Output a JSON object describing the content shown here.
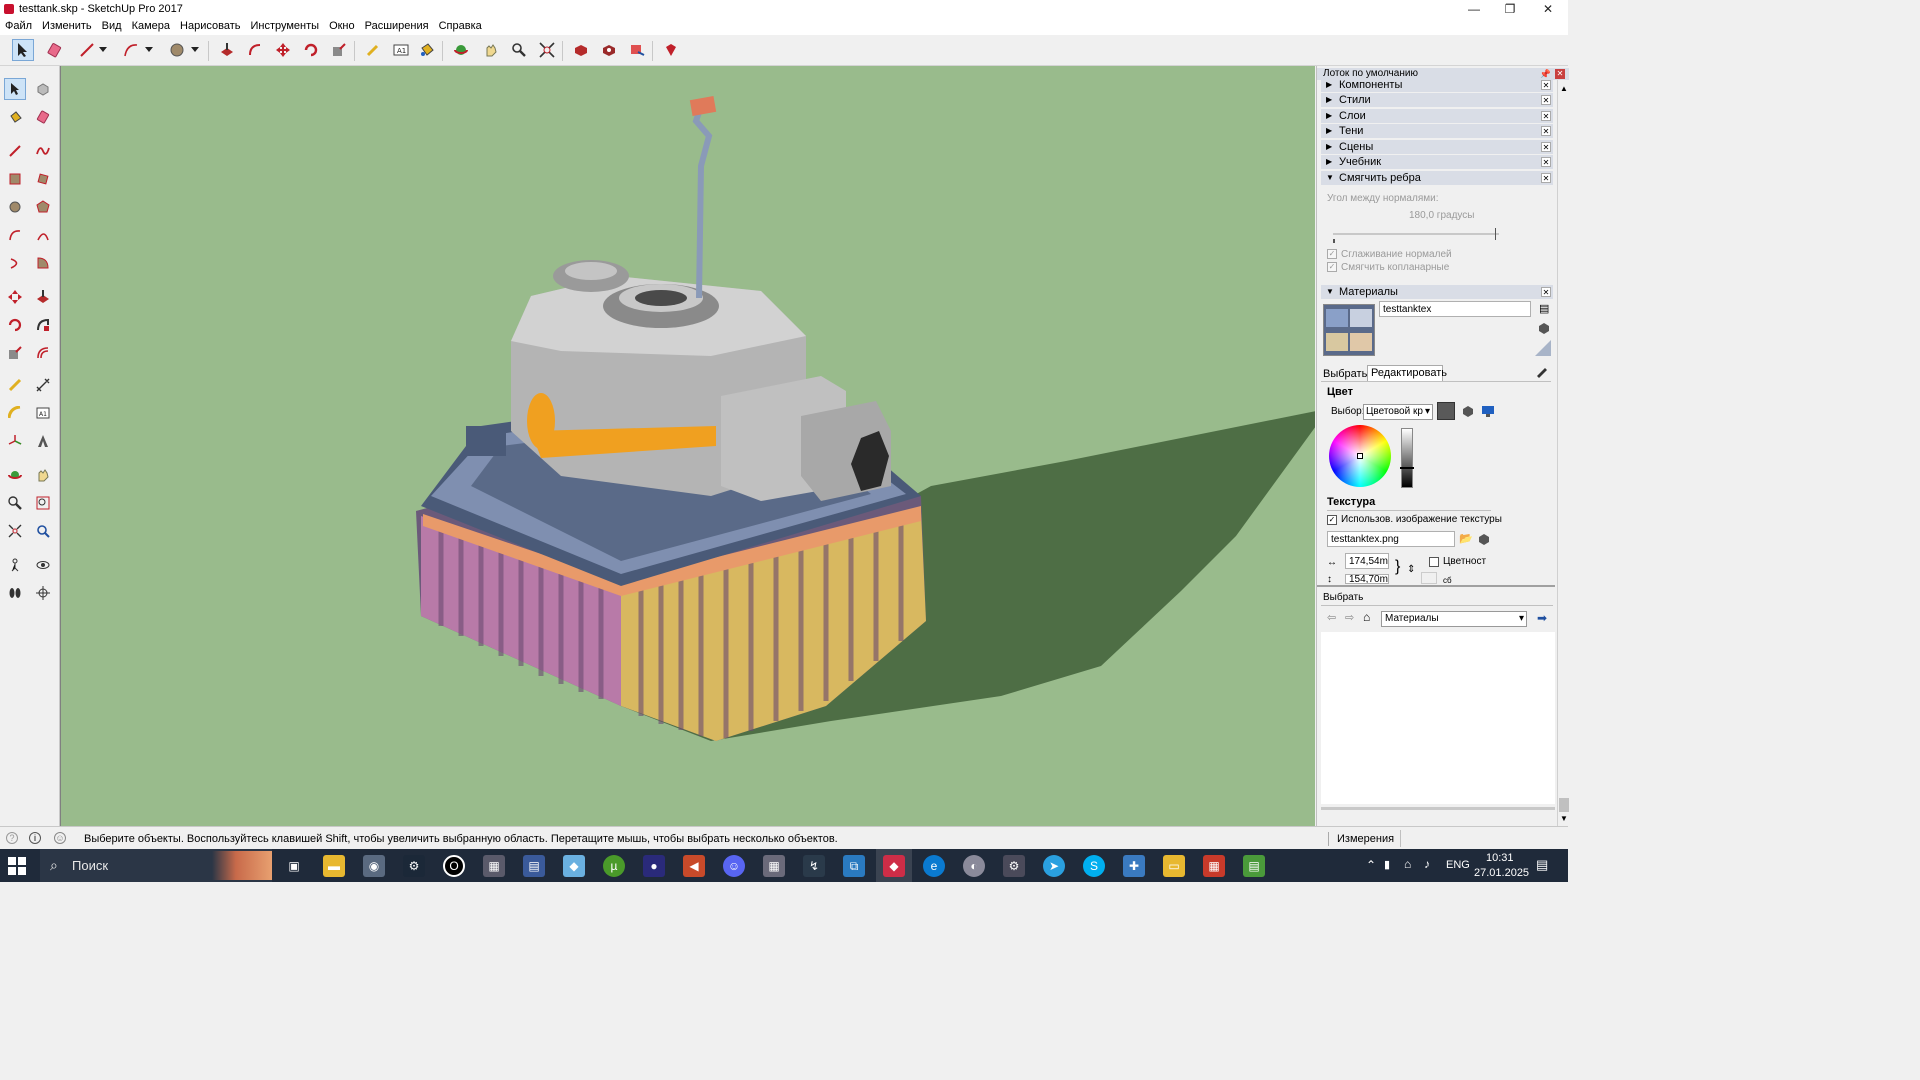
{
  "window": {
    "title": "testtank.skp - SketchUp Pro 2017",
    "minimize": "—",
    "maximize": "❐",
    "close": "✕"
  },
  "menu": [
    "Файл",
    "Изменить",
    "Вид",
    "Камера",
    "Нарисовать",
    "Инструменты",
    "Окно",
    "Расширения",
    "Справка"
  ],
  "tray": {
    "title": "Лоток по умолчанию",
    "panels": [
      "Компоненты",
      "Стили",
      "Слои",
      "Тени",
      "Сцены",
      "Учебник",
      "Смягчить ребра"
    ],
    "soften": {
      "angle_label": "Угол между нормалями:",
      "angle_value": "180,0  градусы",
      "smooth_normals": "Сглаживание нормалей",
      "soften_coplanar": "Смягчить копланарные"
    },
    "materials": {
      "header": "Материалы",
      "name": "testtanktex",
      "tab_select": "Выбрать",
      "tab_edit": "Редактировать",
      "color_section": "Цвет",
      "picker_label": "Выбор:",
      "picker_value": "Цветовой кр",
      "texture_section": "Текстура",
      "use_texture": "Использов. изображение текстуры",
      "texture_file": "testtanktex.png",
      "width_value": "174,54m",
      "height_value": "154,70m",
      "colorize": "Цветност",
      "reset": "сб"
    },
    "select": {
      "title": "Выбрать",
      "library": "Материалы"
    }
  },
  "status": {
    "message": "Выберите объекты. Воспользуйтесь клавишей Shift, чтобы увеличить выбранную область. Перетащите мышь, чтобы выбрать несколько объектов.",
    "measurements_label": "Измерения"
  },
  "taskbar": {
    "search_placeholder": "Поиск",
    "lang": "ENG",
    "time": "10:31",
    "date": "27.01.2025"
  },
  "colors": {
    "sky": "#99bb8c",
    "accent": "#c8102e"
  }
}
